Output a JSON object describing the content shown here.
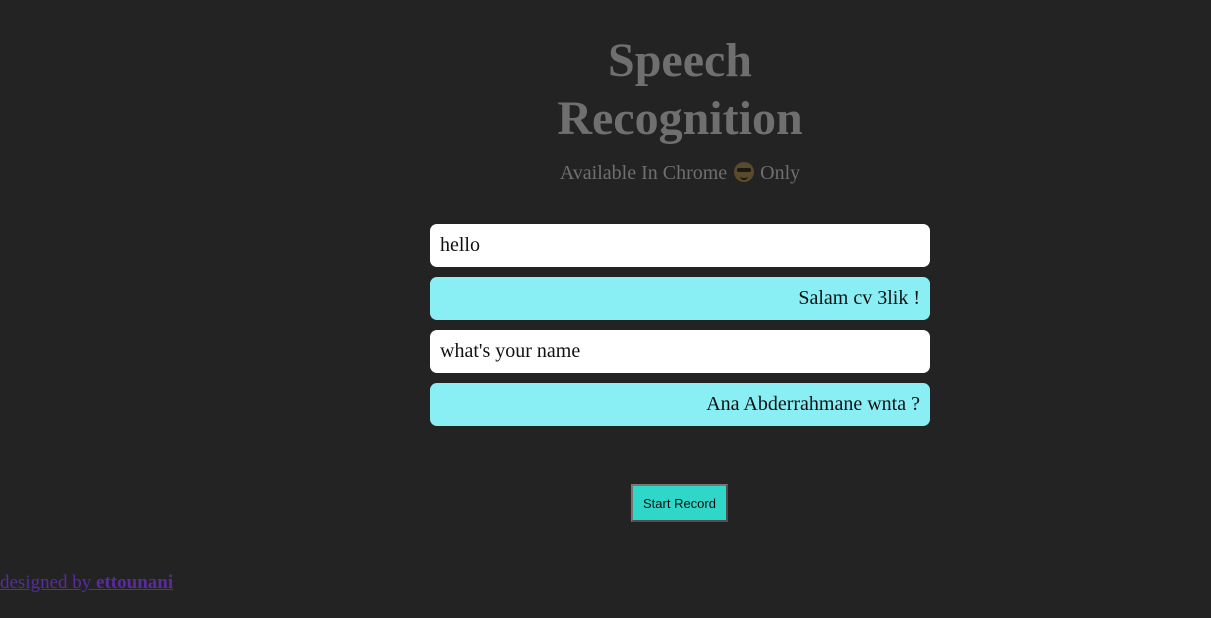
{
  "header": {
    "title_line1": "Speech",
    "title_line2": "Recognition",
    "subtitle_before": "Available In Chrome",
    "subtitle_emoji": "smiling-face-with-sunglasses-icon",
    "subtitle_after": "Only"
  },
  "chat": {
    "messages": [
      {
        "role": "user",
        "text": "hello"
      },
      {
        "role": "bot",
        "text": "Salam cv 3lik !"
      },
      {
        "role": "user",
        "text": "what's your name"
      },
      {
        "role": "bot",
        "text": "Ana Abderrahmane wnta ?"
      }
    ]
  },
  "controls": {
    "record_label": "Start Record"
  },
  "footer": {
    "credit_prefix": "designed by ",
    "credit_author": "ettounani"
  },
  "colors": {
    "background": "#232323",
    "title": "#6f6f6f",
    "user_bubble": "#ffffff",
    "bot_bubble": "#89eff5",
    "record_button": "#2ed7c8",
    "link": "#5a2aa0"
  }
}
